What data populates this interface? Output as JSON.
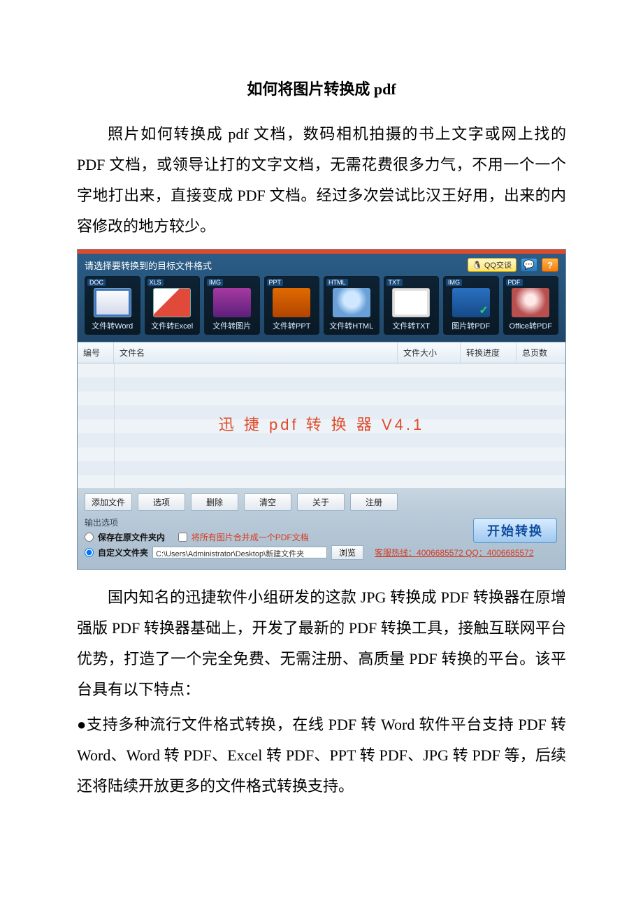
{
  "doc": {
    "title": "如何将图片转换成 pdf",
    "para1": "照片如何转换成 pdf 文档，数码相机拍摄的书上文字或网上找的 PDF 文档，或领导让打的文字文档，无需花费很多力气，不用一个一个字地打出来，直接变成 PDF 文档。经过多次尝试比汉王好用，出来的内容修改的地方较少。",
    "para2": "国内知名的迅捷软件小组研发的这款 JPG 转换成 PDF 转换器在原增强版 PDF 转换器基础上，开发了最新的 PDF 转换工具，接触互联网平台优势，打造了一个完全免费、无需注册、高质量 PDF 转换的平台。该平台具有以下特点：",
    "bullet1": "●支持多种流行文件格式转换，在线 PDF 转 Word 软件平台支持 PDF 转 Word、Word 转 PDF、Excel 转 PDF、PPT 转 PDF、JPG 转 PDF 等，后续还将陆续开放更多的文件格式转换支持。"
  },
  "app": {
    "format_prompt": "请选择要转换到的目标文件格式",
    "qq_label": "QQ交谈",
    "chat_glyph": "💬",
    "help_glyph": "?",
    "tiles": [
      {
        "badge": "DOC",
        "label": "文件转Word",
        "thumb": "doc"
      },
      {
        "badge": "XLS",
        "label": "文件转Excel",
        "thumb": "xls"
      },
      {
        "badge": "IMG",
        "label": "文件转图片",
        "thumb": "img"
      },
      {
        "badge": "PPT",
        "label": "文件转PPT",
        "thumb": "ppt"
      },
      {
        "badge": "HTML",
        "label": "文件转HTML",
        "thumb": "html"
      },
      {
        "badge": "TXT",
        "label": "文件转TXT",
        "thumb": "txt"
      },
      {
        "badge": "IMG",
        "label": "图片转PDF",
        "thumb": "img2"
      },
      {
        "badge": "PDF",
        "label": "Office转PDF",
        "thumb": "pdf"
      }
    ],
    "columns": {
      "num": "编号",
      "name": "文件名",
      "size": "文件大小",
      "prog": "转换进度",
      "pages": "总页数"
    },
    "watermark": "迅 捷 pdf 转 换 器 V4.1",
    "buttons": {
      "add": "添加文件",
      "opt": "选项",
      "del": "删除",
      "clear": "清空",
      "about": "关于",
      "reg": "注册"
    },
    "output": {
      "section_label": "输出选项",
      "save_orig": "保存在原文件夹内",
      "merge": "将所有图片合并成一个PDF文档",
      "custom": "自定义文件夹",
      "path": "C:\\Users\\Administrator\\Desktop\\新建文件夹",
      "browse": "浏览",
      "hotline": "客服热线：4006685572 QQ：4006685572",
      "start": "开始转换"
    }
  }
}
